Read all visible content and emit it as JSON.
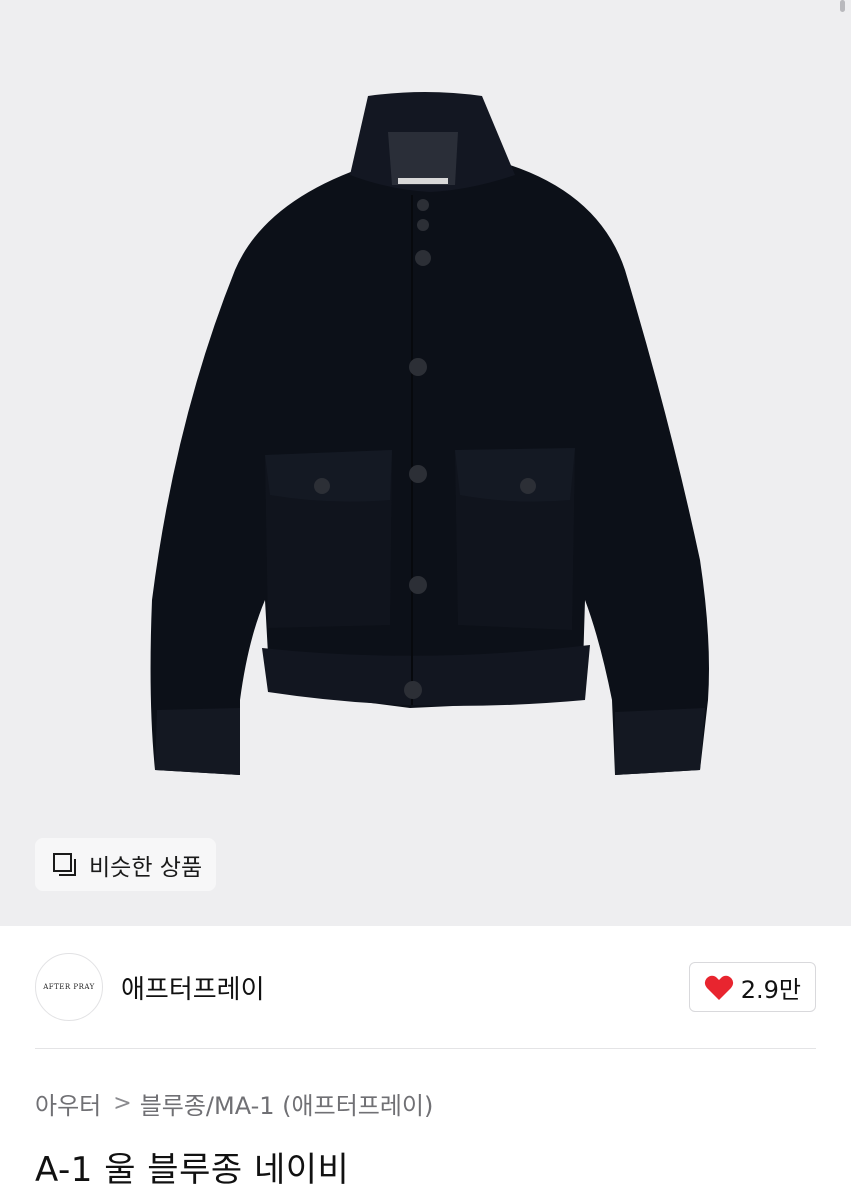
{
  "product_image": {
    "alt": "jacket-photo"
  },
  "similar_button": {
    "label": "비슷한 상품",
    "icon": "similar-items-icon"
  },
  "shop": {
    "logo_text": "AFTER PRAY",
    "name": "애프터프레이"
  },
  "like": {
    "count": "2.9만",
    "icon": "heart-icon",
    "color": "#e8252f"
  },
  "breadcrumb": {
    "category": "아우터",
    "separator": ">",
    "subcategory": "블루종/MA-1 (애프터프레이)"
  },
  "product": {
    "title": "A-1 울 블루종 네이비"
  }
}
